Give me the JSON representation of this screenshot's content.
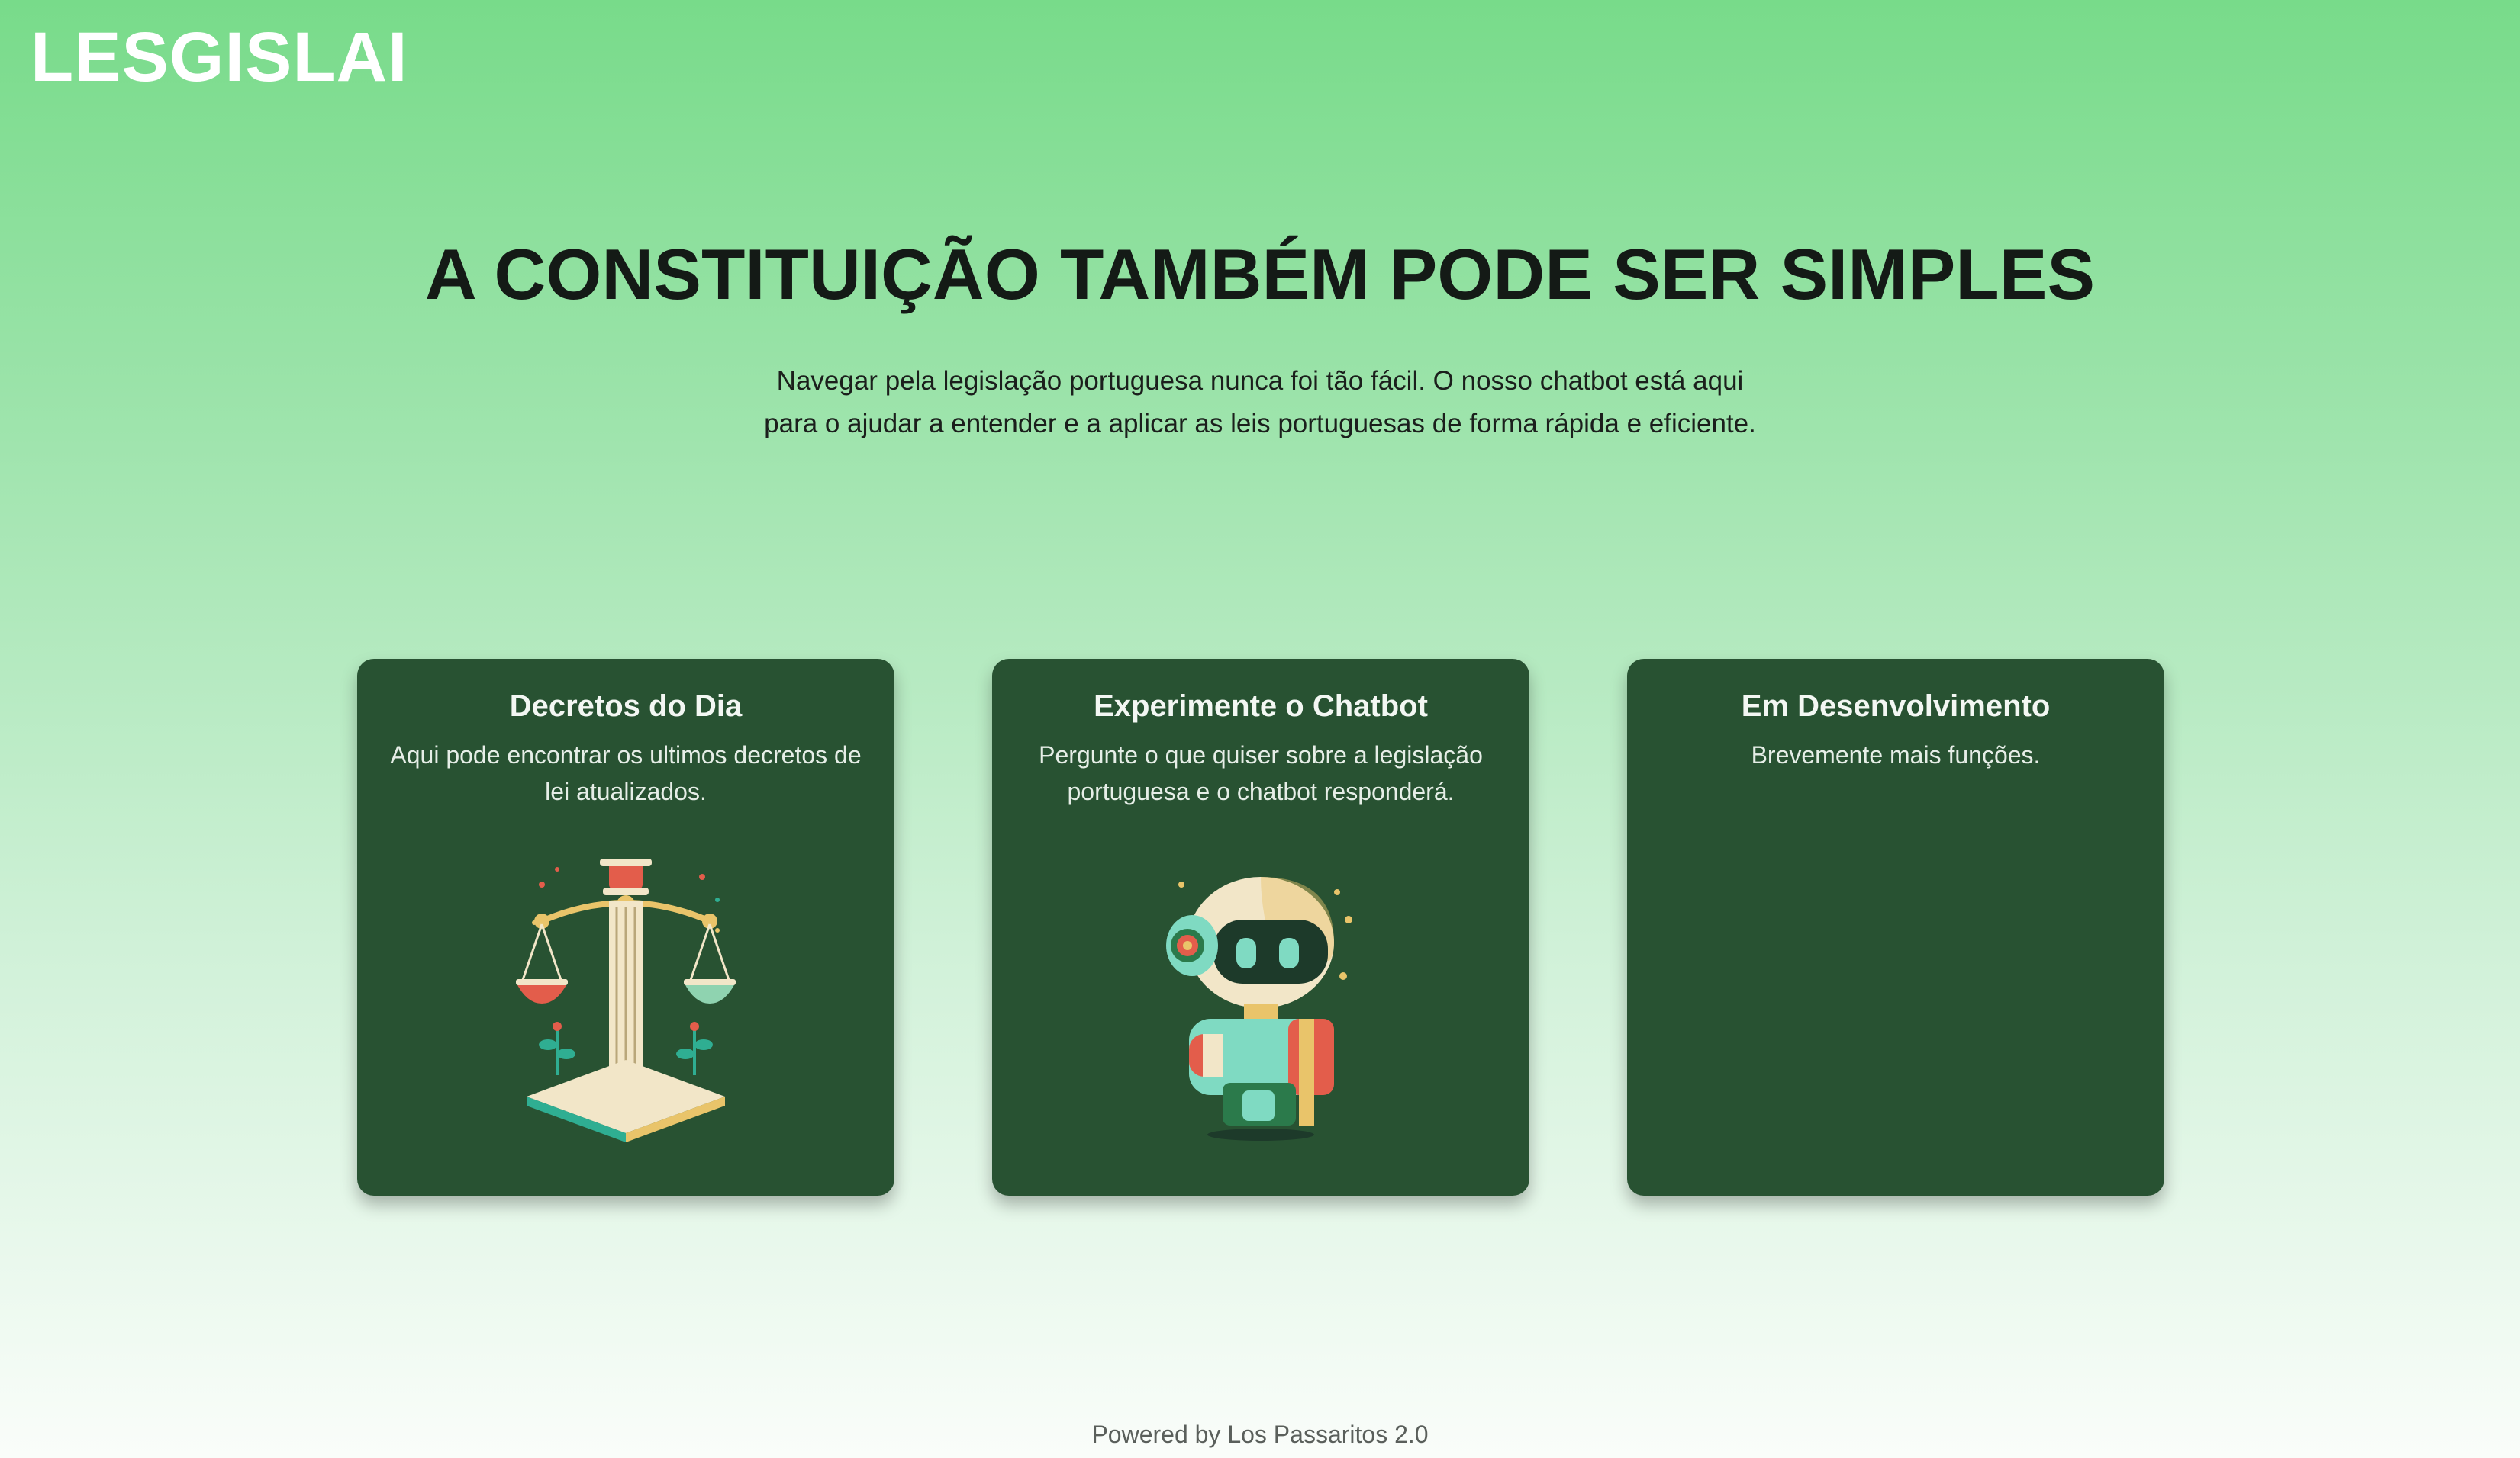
{
  "header": {
    "logo": "LESGISLAI"
  },
  "hero": {
    "title": "A CONSTITUIÇÃO TAMBÉM PODE SER SIMPLES",
    "subtitle": "Navegar pela legislação portuguesa nunca foi tão fácil. O nosso chatbot está aqui para o ajudar a entender e a aplicar as leis portuguesas de forma rápida e eficiente."
  },
  "cards": [
    {
      "title": "Decretos do Dia",
      "description": "Aqui pode encontrar os ultimos decretos de lei atualizados.",
      "icon": "scales-of-justice-icon"
    },
    {
      "title": "Experimente o Chatbot",
      "description": "Pergunte o que quiser sobre a legislação portuguesa e o chatbot responderá.",
      "icon": "robot-chatbot-icon"
    },
    {
      "title": "Em Desenvolvimento",
      "description": "Brevemente mais funções."
    }
  ],
  "footer": {
    "text": "Powered by Los Passaritos 2.0"
  },
  "colors": {
    "card_background": "#285232",
    "gradient_top": "#78db8a",
    "gradient_bottom": "#fafdfa"
  }
}
